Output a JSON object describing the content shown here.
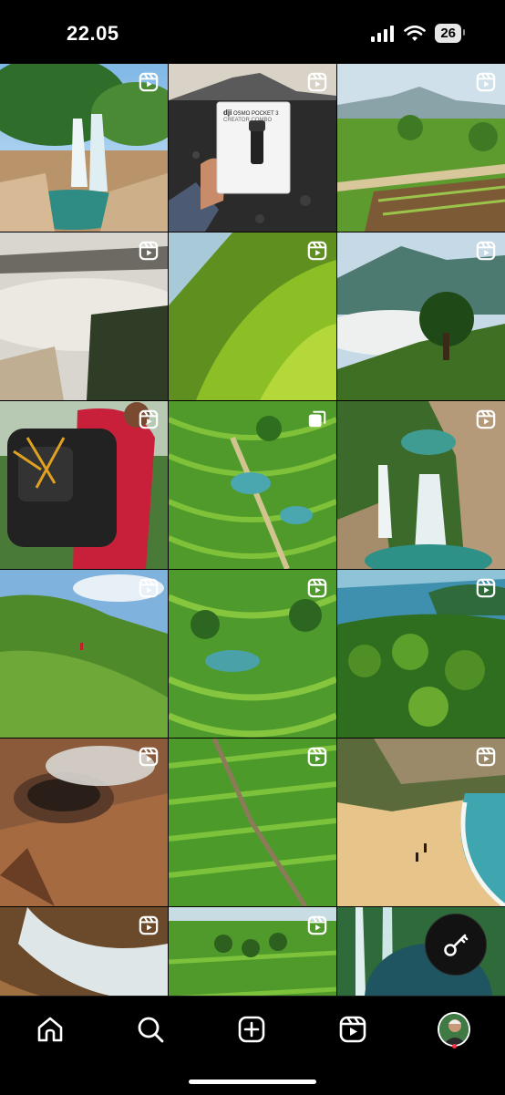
{
  "status_bar": {
    "time": "22.05",
    "battery_level": "26"
  },
  "grid": {
    "tiles": [
      {
        "subject": "waterfall",
        "badge": "reel"
      },
      {
        "subject": "dji-osmo-pocket-box",
        "badge": "reel"
      },
      {
        "subject": "rice-fields-palms",
        "badge": "reel"
      },
      {
        "subject": "sea-of-clouds",
        "badge": "reel"
      },
      {
        "subject": "green-hills",
        "badge": "reel"
      },
      {
        "subject": "tree-on-hill",
        "badge": "reel"
      },
      {
        "subject": "hiker-backpack",
        "badge": "reel"
      },
      {
        "subject": "rice-terraces",
        "badge": "carousel"
      },
      {
        "subject": "waterfall-pool",
        "badge": "reel"
      },
      {
        "subject": "savanna-hills",
        "badge": "reel"
      },
      {
        "subject": "terraced-valley",
        "badge": "reel"
      },
      {
        "subject": "palm-forest-coast",
        "badge": "reel"
      },
      {
        "subject": "volcano-crater",
        "badge": "reel"
      },
      {
        "subject": "rice-field-road",
        "badge": "reel"
      },
      {
        "subject": "beach-cove",
        "badge": "reel"
      },
      {
        "subject": "rock-beach",
        "badge": "reel"
      },
      {
        "subject": "palm-rice-fields",
        "badge": "reel"
      },
      {
        "subject": "jungle-waterfall",
        "badge": "none"
      }
    ]
  },
  "product_box": {
    "brand": "dji",
    "product": "OSMO POCKET 3",
    "edition": "CREATOR COMBO"
  },
  "floating_button": {
    "icon": "key-icon"
  },
  "nav": {
    "items": [
      {
        "name": "home",
        "icon": "home-icon"
      },
      {
        "name": "search",
        "icon": "search-icon"
      },
      {
        "name": "create",
        "icon": "plus-square-icon"
      },
      {
        "name": "reels",
        "icon": "reels-icon"
      },
      {
        "name": "profile",
        "icon": "avatar"
      }
    ]
  }
}
